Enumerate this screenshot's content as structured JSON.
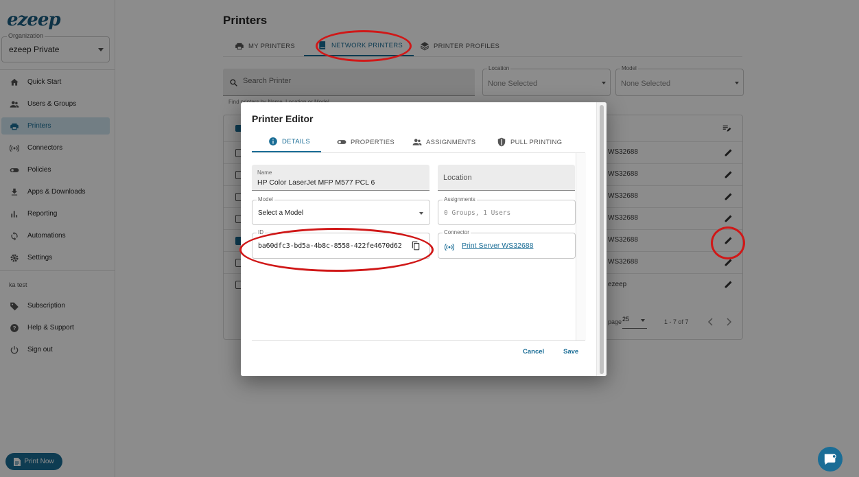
{
  "sidebar": {
    "logo": "ezeep",
    "org_label": "Organization",
    "org_value": "ezeep Private",
    "items": [
      {
        "label": "Quick Start",
        "icon": "home-icon"
      },
      {
        "label": "Users & Groups",
        "icon": "people-icon"
      },
      {
        "label": "Printers",
        "icon": "printer-icon",
        "active": true
      },
      {
        "label": "Connectors",
        "icon": "connector-icon"
      },
      {
        "label": "Policies",
        "icon": "toggle-icon"
      },
      {
        "label": "Apps & Downloads",
        "icon": "download-icon"
      },
      {
        "label": "Reporting",
        "icon": "bar-chart-icon"
      },
      {
        "label": "Automations",
        "icon": "sync-icon"
      },
      {
        "label": "Settings",
        "icon": "gear-icon"
      }
    ],
    "section_label": "ka test",
    "bottom_items": [
      {
        "label": "Subscription",
        "icon": "tag-icon"
      },
      {
        "label": "Help & Support",
        "icon": "help-icon"
      },
      {
        "label": "Sign out",
        "icon": "power-icon"
      }
    ],
    "print_now": "Print Now"
  },
  "main": {
    "title": "Printers",
    "tabs": [
      "MY PRINTERS",
      "NETWORK PRINTERS",
      "PRINTER PROFILES"
    ],
    "search_placeholder": "Search Printer",
    "search_helper": "Find printers by Name, Location or Model",
    "location_label": "Location",
    "location_value": "None Selected",
    "model_label": "Model",
    "model_value": "None Selected",
    "rows": [
      {
        "connector": "WS32688",
        "checked": false
      },
      {
        "connector": "WS32688",
        "checked": false
      },
      {
        "connector": "WS32688",
        "checked": false
      },
      {
        "connector": "WS32688",
        "checked": false
      },
      {
        "connector": "WS32688",
        "checked": true
      },
      {
        "connector": "WS32688",
        "checked": false
      },
      {
        "connector": "ezeep",
        "checked": false
      }
    ],
    "pager": {
      "rows_label": "page",
      "per_page": "25",
      "range": "1 - 7 of 7"
    }
  },
  "dialog": {
    "title": "Printer Editor",
    "tabs": [
      "DETAILS",
      "PROPERTIES",
      "ASSIGNMENTS",
      "PULL PRINTING"
    ],
    "name_label": "Name",
    "name_value": "HP Color LaserJet MFP M577 PCL 6",
    "location_placeholder": "Location",
    "model_label": "Model",
    "model_value": "Select a Model",
    "assignments_label": "Assignments",
    "assignments_value": "0 Groups, 1 Users",
    "id_label": "ID",
    "id_value": "ba60dfc3-bd5a-4b8c-8558-422fe4670d62",
    "connector_label": "Connector",
    "connector_value": "Print Server WS32688",
    "cancel": "Cancel",
    "save": "Save"
  },
  "colors": {
    "accent": "#1a6d96",
    "annotation": "#d01818"
  }
}
